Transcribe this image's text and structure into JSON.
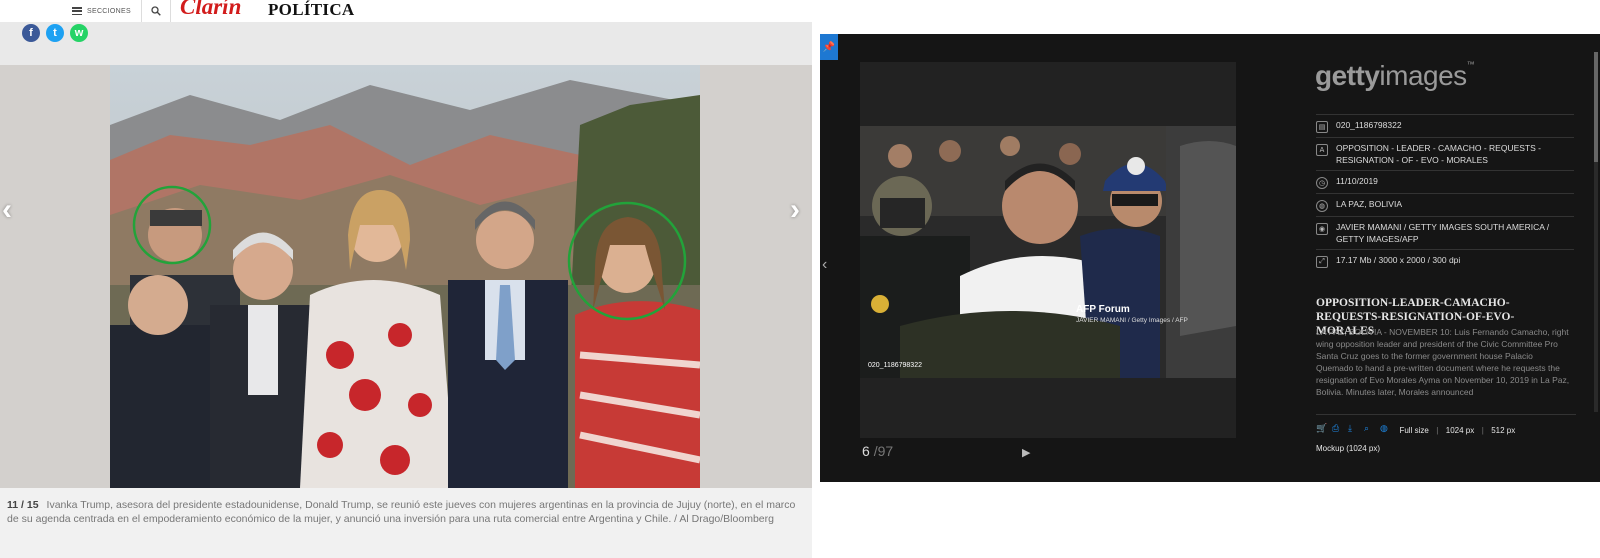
{
  "left_page": {
    "header": {
      "menu_label": "SECCIONES",
      "logo": "Clarín",
      "section": "POLÍTICA"
    },
    "gallery": {
      "counter": "11 / 15",
      "caption": "Ivanka Trump, asesora del presidente estadounidense, Donald Trump, se reunió este jueves con mujeres argentinas en la provincia de Jujuy (norte), en el marco de su agenda centrada en el empoderamiento económico de la mujer, y anunció una inversión para una ruta comercial entre Argentina y Chile. / Al Drago/Bloomberg"
    },
    "colors": {
      "logo": "#d21c1c",
      "highlight_circle": "#22a33a"
    }
  },
  "right_page": {
    "brand": {
      "name": "getty",
      "name_light": "images",
      "tm": "™"
    },
    "photo": {
      "code": "020_1186798322",
      "watermark": "AFP Forum",
      "watermark_credit": "JAVIER MAMANI / Getty Images / AFP"
    },
    "pager": {
      "current": "6",
      "total": "/97"
    },
    "metadata": [
      {
        "icon": "document-icon",
        "text": "020_1186798322"
      },
      {
        "icon": "text-icon",
        "text": "OPPOSITION - LEADER - CAMACHO - REQUESTS - RESIGNATION - OF - EVO - MORALES"
      },
      {
        "icon": "clock-icon",
        "text": "11/10/2019"
      },
      {
        "icon": "globe-icon",
        "text": "LA PAZ, BOLIVIA"
      },
      {
        "icon": "camera-icon",
        "text": "JAVIER MAMANI / GETTY IMAGES SOUTH AMERICA / GETTY IMAGES/AFP"
      },
      {
        "icon": "resize-icon",
        "text": "17.17 Mb / 3000 x 2000 / 300 dpi"
      }
    ],
    "headline": "OPPOSITION-LEADER-CAMACHO-REQUESTS-RESIGNATION-OF-EVO-MORALES",
    "description": "LA PAZ, BOLIVIA - NOVEMBER 10: Luis Fernando Camacho, right wing opposition leader and president of the Civic Committee Pro Santa Cruz goes to the former government house Palacio Quemado to hand a pre-written document where he requests the resignation of Evo Morales Ayma on November 10, 2019 in La Paz, Bolivia. Minutes later, Morales announced",
    "toolbar": {
      "full_size": "Full size",
      "size_1024": "1024 px",
      "size_512": "512 px",
      "mockup": "Mockup (1024 px)"
    },
    "colors": {
      "accent": "#1e88e5",
      "background": "#151515"
    }
  }
}
